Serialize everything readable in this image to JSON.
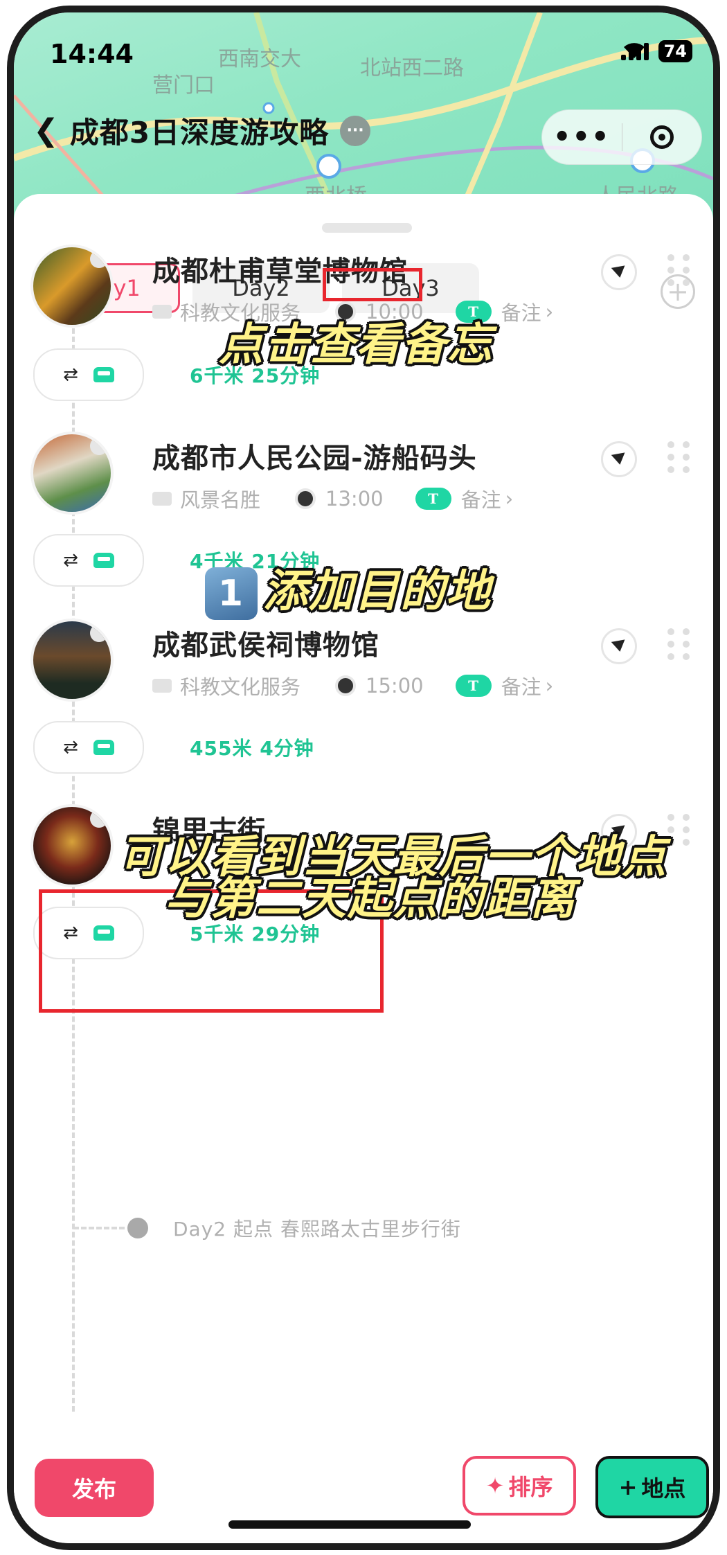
{
  "status_bar": {
    "time": "14:44",
    "battery": "74"
  },
  "map_labels": [
    "西南交大",
    "营门口",
    "北站西二路",
    "西北桥",
    "人民北路"
  ],
  "header": {
    "title": "成都3日深度游攻略",
    "more_label": "···"
  },
  "tabs": [
    {
      "label": "Day1",
      "active": true
    },
    {
      "label": "Day2",
      "active": false
    },
    {
      "label": "Day3",
      "active": false
    }
  ],
  "add_day_label": "+",
  "stops": [
    {
      "name": "成都杜甫草堂博物馆",
      "category": "科教文化服务",
      "time": "10:00",
      "note_badge": "T",
      "note_label": "备注"
    },
    {
      "name": "成都市人民公园-游船码头",
      "category": "风景名胜",
      "time": "13:00",
      "note_badge": "T",
      "note_label": "备注"
    },
    {
      "name": "成都武侯祠博物馆",
      "category": "科教文化服务",
      "time": "15:00",
      "note_badge": "T",
      "note_label": "备注"
    },
    {
      "name": "锦里古街"
    }
  ],
  "transits": [
    {
      "text": "6千米 25分钟"
    },
    {
      "text": "4千米 21分钟"
    },
    {
      "text": "455米 4分钟"
    },
    {
      "text": "5千米 29分钟"
    }
  ],
  "day2_start": "Day2 起点 春熙路太古里步行街",
  "captions": {
    "tap_note": "点击查看备忘",
    "add_destination_num": "1",
    "add_destination": "添加目的地",
    "distance_line1": "可以看到当天最后一个地点",
    "distance_line2": "与第二天起点的距离"
  },
  "bottom": {
    "publish": "发布",
    "sort": "排序",
    "add_place": "地点"
  },
  "colors": {
    "accent_pink": "#f0486a",
    "accent_green": "#1fd6a4",
    "highlight_red": "#e8262e"
  }
}
